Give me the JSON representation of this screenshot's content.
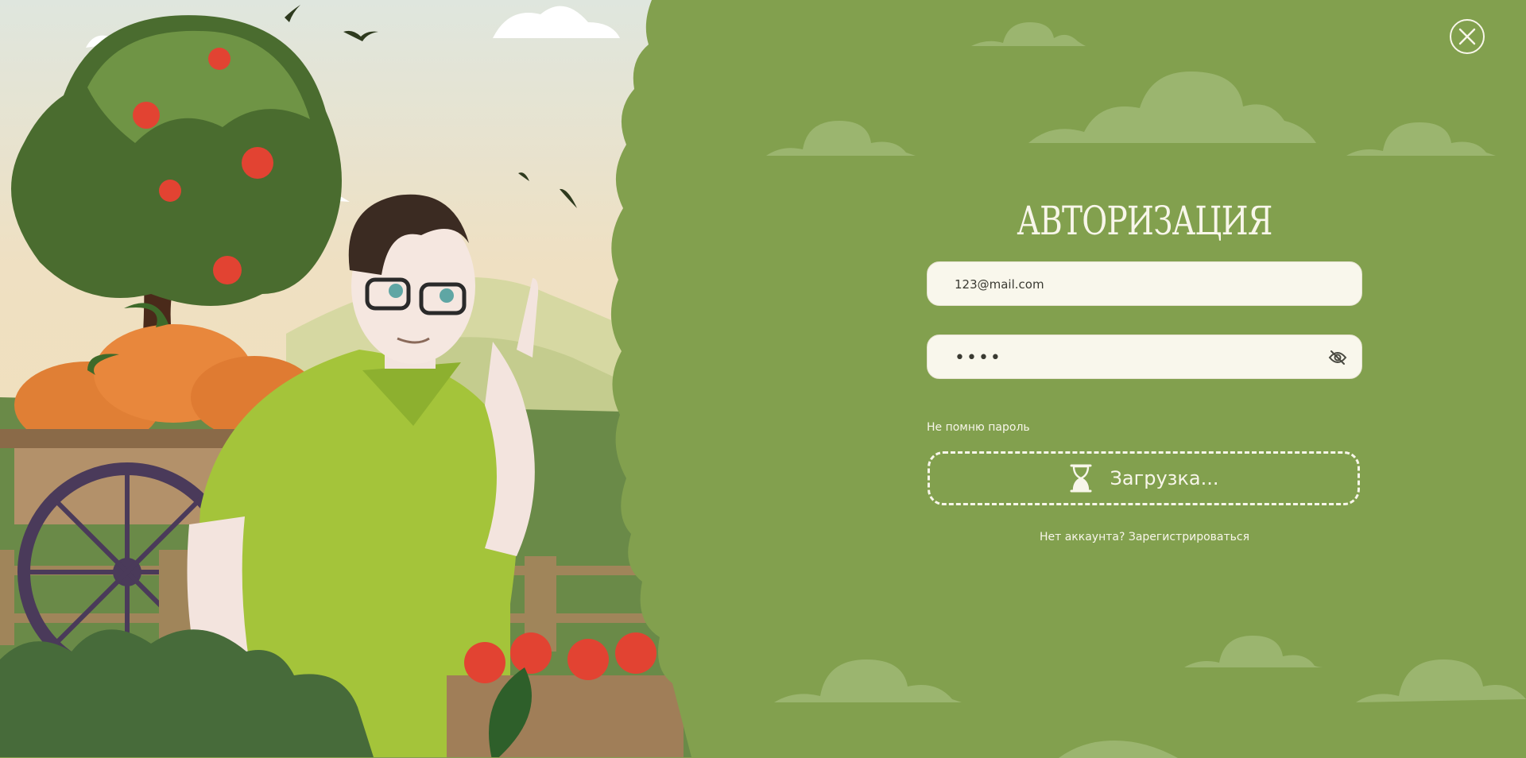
{
  "auth": {
    "title": "АВТОРИЗАЦИЯ",
    "email_value": "123@mail.com",
    "password_value": "••••",
    "forgot_label": "Не помню пароль",
    "submit_label": "Загрузка...",
    "register_label": "Нет аккаунта? Зарегистрироваться"
  },
  "icons": {
    "close": "close-icon",
    "eye": "eye-off-icon",
    "submit": "hourglass-icon"
  },
  "colors": {
    "panel_background": "#82a04e",
    "input_background": "#f9f7ec",
    "text_light": "#f8f6ea",
    "cloud": "#9bb56f"
  }
}
